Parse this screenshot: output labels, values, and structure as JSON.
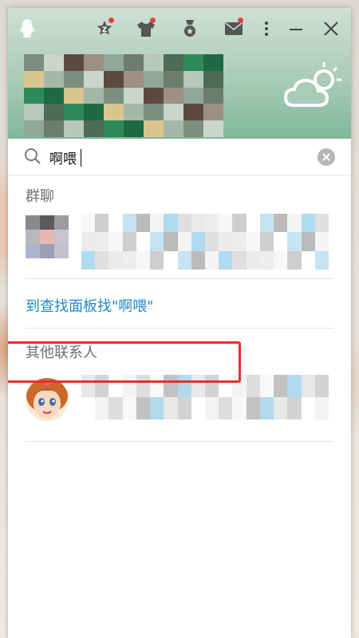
{
  "search": {
    "value": "啊喂"
  },
  "sections": {
    "group_chat": "群聊",
    "find_link": "到查找面板找\"啊喂\"",
    "other_contacts": "其他联系人"
  },
  "icons": {
    "logo": "qq-penguin-icon",
    "zone": "qzone-icon",
    "shirt": "dress-up-icon",
    "medal": "medal-icon",
    "mail": "mail-icon",
    "more": "more-icon",
    "minimize": "minimize-icon",
    "close": "close-icon",
    "weather": "partly-cloudy-icon",
    "search": "search-icon",
    "clear": "clear-icon"
  },
  "colors": {
    "link": "#1f88c8",
    "highlight": "#e53030",
    "badge": "#e8413b"
  }
}
